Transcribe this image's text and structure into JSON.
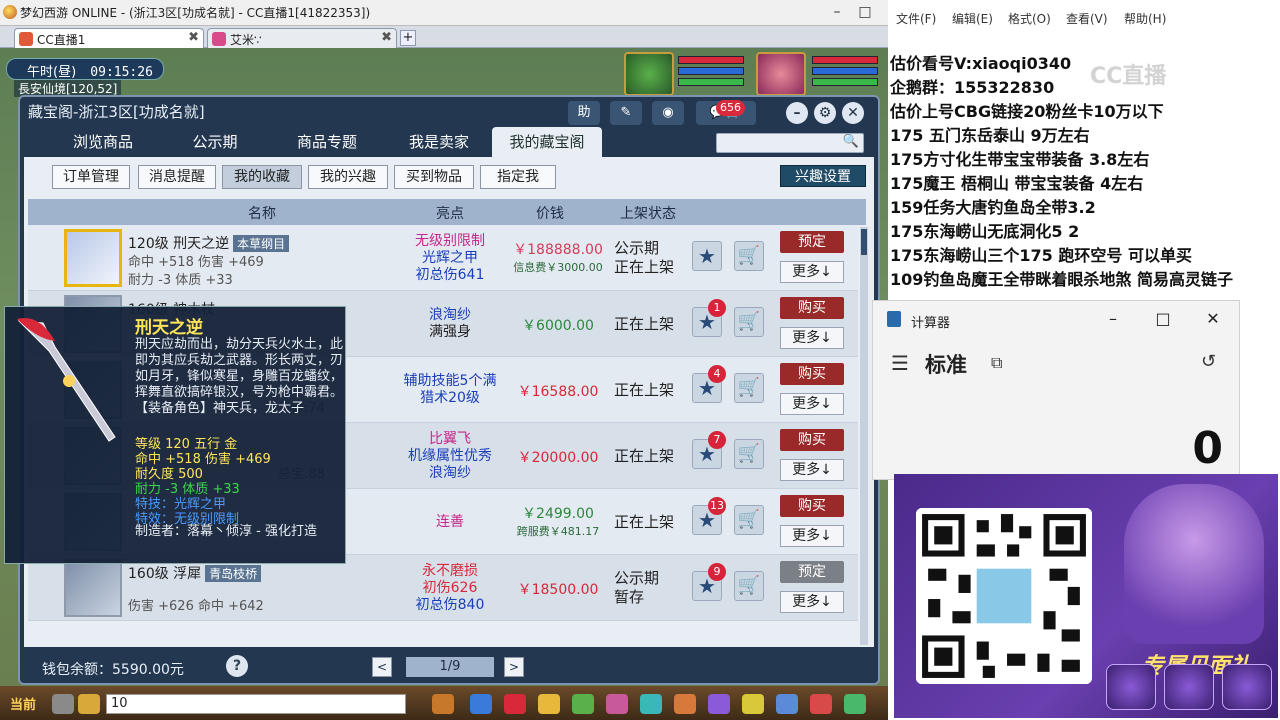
{
  "window": {
    "title": "梦幻西游 ONLINE - (浙江3区[功成名就] - CC直播1[41822353])",
    "tabs": [
      {
        "label": "CC直播1",
        "active": true
      },
      {
        "label": "艾米∵",
        "active": false
      }
    ]
  },
  "hud": {
    "time_period": "午时(昼)",
    "time": "09:15:26",
    "location": "長安仙境[120,52]"
  },
  "cbg": {
    "title": "藏宝阁-浙江3区[功成名就]",
    "help_label": "助",
    "message_count": "656",
    "nav_tabs": [
      "浏览商品",
      "公示期",
      "商品专题",
      "我是卖家",
      "我的藏宝阁"
    ],
    "active_nav": "我的藏宝阁",
    "sub_tabs": [
      "订单管理",
      "消息提醒",
      "我的收藏",
      "我的兴趣",
      "买到物品",
      "指定我"
    ],
    "active_sub": "我的收藏",
    "interest_settings": "兴趣设置",
    "columns": [
      "名称",
      "亮点",
      "价钱",
      "上架状态"
    ],
    "items": [
      {
        "name": "120级 刑天之逆",
        "tag": "本草纲目",
        "stat1": "命中 +518 伤害 +469",
        "stat2": "耐力 -3 体质 +33",
        "highlights": [
          "无级别限制",
          "光辉之甲",
          "初总伤641"
        ],
        "highlight_colors": [
          "#c8278b",
          "#1a3fb8",
          "#1a3fb8"
        ],
        "price": "￥188888.00",
        "price_color": "#d83a5a",
        "fee": "信息费￥3000.00",
        "status": [
          "公示期",
          "正在上架"
        ],
        "fav_count": "",
        "action": "预定",
        "action_type": "reserve",
        "more": "更多↓"
      },
      {
        "name": "160级 神木杖",
        "tag": "",
        "stat1": "",
        "stat2": "",
        "highlights": [
          "浪淘纱",
          "满强身"
        ],
        "highlight_colors": [
          "#1a3fb8",
          "#222222"
        ],
        "price": "￥6000.00",
        "price_color": "#2a8a3a",
        "fee": "",
        "status": [
          "正在上架"
        ],
        "fav_count": "1",
        "action": "购买",
        "action_type": "buy",
        "more": "更多↓"
      },
      {
        "name": "",
        "tag": "",
        "stat1": "",
        "stat2": "灵修:74",
        "highlights": [
          "辅助技能5个满",
          "猎术20级"
        ],
        "highlight_colors": [
          "#1a3fb8",
          "#1a3fb8"
        ],
        "price": "￥16588.00",
        "price_color": "#d8283a",
        "fee": "",
        "status": [
          "正在上架"
        ],
        "fav_count": "4",
        "action": "购买",
        "action_type": "buy",
        "more": "更多↓"
      },
      {
        "name": "",
        "tag": "",
        "stat1": "",
        "stat2": "总宝:88",
        "highlights": [
          "比翼飞",
          "机缘属性优秀",
          "浪淘纱"
        ],
        "highlight_colors": [
          "#c8278b",
          "#1a3fb8",
          "#1a3fb8"
        ],
        "price": "￥20000.00",
        "price_color": "#d8283a",
        "fee": "",
        "status": [
          "正在上架"
        ],
        "fav_count": "7",
        "action": "购买",
        "action_type": "buy",
        "more": "更多↓"
      },
      {
        "name": "",
        "tag": "",
        "stat1": "",
        "stat2": "",
        "highlights": [
          "连善"
        ],
        "highlight_colors": [
          "#c8278b"
        ],
        "price": "￥2499.00",
        "price_color": "#2a8a3a",
        "fee": "跨服费￥481.17",
        "status": [
          "正在上架"
        ],
        "fav_count": "13",
        "action": "购买",
        "action_type": "buy",
        "more": "更多↓"
      },
      {
        "name": "160级 浮犀",
        "tag": "青岛枝桥",
        "stat1": "",
        "stat2": "伤害 +626 命中 +642",
        "highlights": [
          "永不磨损",
          "初伤626",
          "初总伤840"
        ],
        "highlight_colors": [
          "#d8283a",
          "#d8283a",
          "#1a3fb8"
        ],
        "price": "￥18500.00",
        "price_color": "#d8283a",
        "fee": "",
        "status": [
          "公示期",
          "暂存"
        ],
        "fav_count": "9",
        "action": "预定",
        "action_type": "disabled",
        "more": "更多↓"
      }
    ],
    "wallet": "钱包余额：5590.00元",
    "page": "1/9",
    "prev": "<",
    "next": ">"
  },
  "tooltip": {
    "name": "刑天之逆",
    "desc": "刑天应劫而出，劫分天兵火水土，此即为其应兵劫之武器。形长两丈，刃如月牙，锋似寒星，身雕百龙蟠纹，挥舞直欲搞碎银汉，号为枪中霸君。",
    "role": "【装备角色】神天兵，龙太子",
    "lines": [
      {
        "text": "等级 120  五行 金",
        "color": "#ffe45a"
      },
      {
        "text": "命中 +518 伤害 +469",
        "color": "#ffe45a"
      },
      {
        "text": "耐久度 500",
        "color": "#ffe45a"
      },
      {
        "text": "耐力 -3 体质 +33",
        "color": "#3ad84a"
      },
      {
        "text": "特技：光辉之甲",
        "color": "#4a9bff"
      },
      {
        "text": "特效：无级别限制",
        "color": "#4a9bff"
      }
    ],
    "maker": "制造者：落幕丶倾淳 - 强化打造"
  },
  "gamebar": {
    "channel": "当前",
    "chat_value": "10"
  },
  "notepad": {
    "menu": [
      "文件(F)",
      "编辑(E)",
      "格式(O)",
      "查看(V)",
      "帮助(H)"
    ],
    "lines": [
      "估价看号V:xiaoqi0340",
      "企鹅群：155322830",
      "估价上号CBG链接20粉丝卡10万以下",
      "175 五门东岳泰山  9万左右",
      "175方寸化生带宝宝带装备  3.8左右",
      "175魔王 梧桐山  带宝宝装备 4左右",
      "159任务大唐钓鱼岛全带3.2",
      "175东海崂山无底洞化5  2",
      "175东海崂山三个175 跑环空号 可以单买",
      "109钓鱼岛魔王全带眯着眼杀地煞 简易高灵链子"
    ],
    "watermark": "CC直播"
  },
  "calculator": {
    "title": "计算器",
    "mode": "标准",
    "display": "0"
  },
  "promo": {
    "title": "专属见面礼"
  }
}
